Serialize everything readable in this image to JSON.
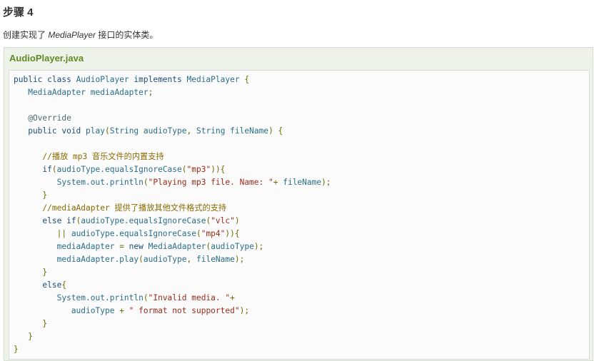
{
  "step": {
    "heading": "步骤 4",
    "desc_before": "创建实现了 ",
    "desc_italic": "MediaPlayer",
    "desc_after": " 接口的实体类。"
  },
  "file": {
    "title": "AudioPlayer.java"
  },
  "code_lines": [
    [
      {
        "t": "public class ",
        "c": "kw"
      },
      {
        "t": "AudioPlayer ",
        "c": "id"
      },
      {
        "t": "implements ",
        "c": "kw"
      },
      {
        "t": "MediaPlayer ",
        "c": "id"
      },
      {
        "t": "{",
        "c": "pn"
      }
    ],
    [
      {
        "t": "   MediaAdapter mediaAdapter",
        "c": "id"
      },
      {
        "t": ";",
        "c": "pn"
      }
    ],
    [],
    [
      {
        "t": "   ",
        "c": "id"
      },
      {
        "t": "@Override",
        "c": "an"
      }
    ],
    [
      {
        "t": "   public void ",
        "c": "kw"
      },
      {
        "t": "play",
        "c": "id"
      },
      {
        "t": "(",
        "c": "pn"
      },
      {
        "t": "String audioType",
        "c": "id"
      },
      {
        "t": ", ",
        "c": "pn"
      },
      {
        "t": "String fileName",
        "c": "id"
      },
      {
        "t": ") {",
        "c": "pn"
      }
    ],
    [],
    [
      {
        "t": "      //播放 mp3 音乐文件的内置支持",
        "c": "cm"
      }
    ],
    [
      {
        "t": "      if",
        "c": "kw"
      },
      {
        "t": "(",
        "c": "pn"
      },
      {
        "t": "audioType.equalsIgnoreCase",
        "c": "id"
      },
      {
        "t": "(",
        "c": "pn"
      },
      {
        "t": "\"mp3\"",
        "c": "str"
      },
      {
        "t": ")){",
        "c": "pn"
      }
    ],
    [
      {
        "t": "         System.out.println",
        "c": "id"
      },
      {
        "t": "(",
        "c": "pn"
      },
      {
        "t": "\"Playing mp3 file. Name: \"",
        "c": "str"
      },
      {
        "t": "+ ",
        "c": "pn"
      },
      {
        "t": "fileName",
        "c": "id"
      },
      {
        "t": ");",
        "c": "pn"
      }
    ],
    [
      {
        "t": "      }",
        "c": "pn"
      }
    ],
    [
      {
        "t": "      //mediaAdapter 提供了播放其他文件格式的支持",
        "c": "cm"
      }
    ],
    [
      {
        "t": "      else if",
        "c": "kw"
      },
      {
        "t": "(",
        "c": "pn"
      },
      {
        "t": "audioType.equalsIgnoreCase",
        "c": "id"
      },
      {
        "t": "(",
        "c": "pn"
      },
      {
        "t": "\"vlc\"",
        "c": "str"
      },
      {
        "t": ")",
        "c": "pn"
      }
    ],
    [
      {
        "t": "         || ",
        "c": "pn"
      },
      {
        "t": "audioType.equalsIgnoreCase",
        "c": "id"
      },
      {
        "t": "(",
        "c": "pn"
      },
      {
        "t": "\"mp4\"",
        "c": "str"
      },
      {
        "t": ")){",
        "c": "pn"
      }
    ],
    [
      {
        "t": "         mediaAdapter ",
        "c": "id"
      },
      {
        "t": "= ",
        "c": "pn"
      },
      {
        "t": "new ",
        "c": "kw"
      },
      {
        "t": "MediaAdapter",
        "c": "id"
      },
      {
        "t": "(",
        "c": "pn"
      },
      {
        "t": "audioType",
        "c": "id"
      },
      {
        "t": ");",
        "c": "pn"
      }
    ],
    [
      {
        "t": "         mediaAdapter.play",
        "c": "id"
      },
      {
        "t": "(",
        "c": "pn"
      },
      {
        "t": "audioType",
        "c": "id"
      },
      {
        "t": ", ",
        "c": "pn"
      },
      {
        "t": "fileName",
        "c": "id"
      },
      {
        "t": ");",
        "c": "pn"
      }
    ],
    [
      {
        "t": "      }",
        "c": "pn"
      }
    ],
    [
      {
        "t": "      else",
        "c": "kw"
      },
      {
        "t": "{",
        "c": "pn"
      }
    ],
    [
      {
        "t": "         System.out.println",
        "c": "id"
      },
      {
        "t": "(",
        "c": "pn"
      },
      {
        "t": "\"Invalid media. \"",
        "c": "str"
      },
      {
        "t": "+",
        "c": "pn"
      }
    ],
    [
      {
        "t": "            audioType ",
        "c": "id"
      },
      {
        "t": "+ ",
        "c": "pn"
      },
      {
        "t": "\" format not supported\"",
        "c": "str"
      },
      {
        "t": ");",
        "c": "pn"
      }
    ],
    [
      {
        "t": "      }",
        "c": "pn"
      }
    ],
    [
      {
        "t": "   }",
        "c": "pn"
      }
    ],
    [
      {
        "t": "}",
        "c": "pn"
      }
    ]
  ]
}
